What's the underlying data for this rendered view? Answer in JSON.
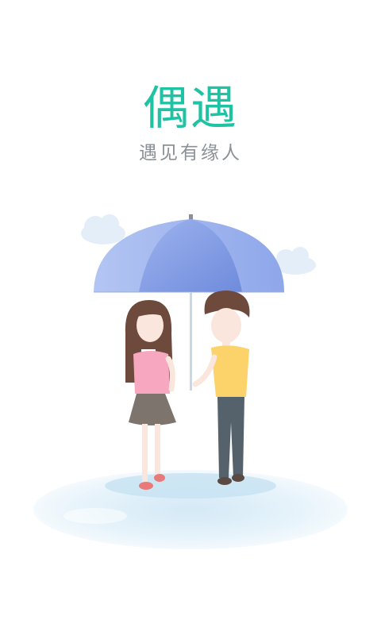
{
  "splash": {
    "title": "偶遇",
    "subtitle": "遇见有缘人"
  },
  "colors": {
    "accent": "#1fc3a3",
    "subtitle": "#8b9196",
    "umbrella": "#7f9be3",
    "girl_shirt": "#f7a8c0",
    "boy_shirt": "#fbd36a",
    "boy_pants": "#55626b",
    "hair": "#6e4a3d",
    "puddle": "#d6ecf7"
  },
  "illustration": {
    "icons": [
      "cloud-icon",
      "umbrella-icon",
      "girl-figure-icon",
      "boy-figure-icon",
      "puddle-icon"
    ]
  }
}
